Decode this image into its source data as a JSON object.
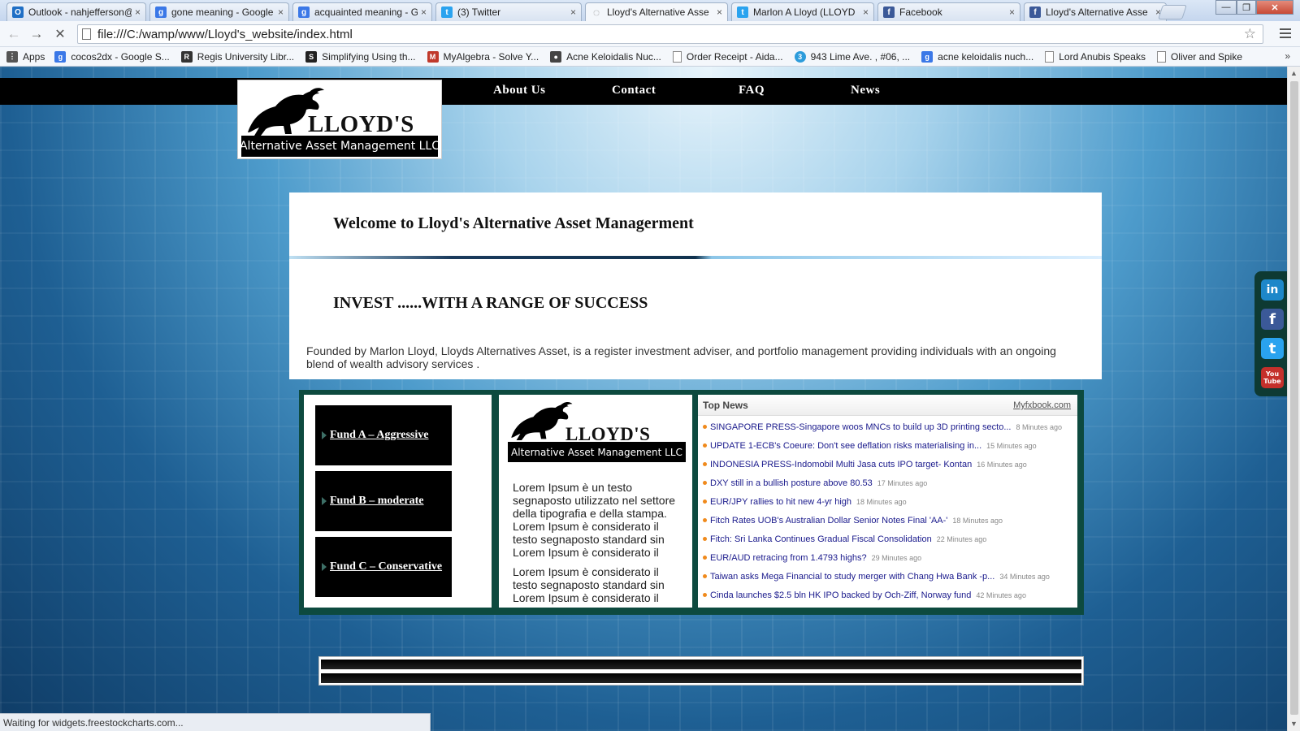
{
  "browser": {
    "tabs": [
      {
        "label": "Outlook - nahjefferson@",
        "favicon": "outlook-icon",
        "color": "#1f6fc5",
        "glyph": "O"
      },
      {
        "label": "gone meaning - Google",
        "favicon": "google-icon",
        "color": "#3b78e7",
        "glyph": "g"
      },
      {
        "label": "acquainted meaning - G",
        "favicon": "google-icon",
        "color": "#3b78e7",
        "glyph": "g"
      },
      {
        "label": "(3) Twitter",
        "favicon": "twitter-icon",
        "color": "#2aa3ef",
        "glyph": "t"
      },
      {
        "label": "Lloyd's Alternative Asse",
        "favicon": "loading-icon",
        "color": "#888888",
        "glyph": "◌"
      },
      {
        "label": "Marlon A Lloyd (LLOYD",
        "favicon": "twitter-icon",
        "color": "#2aa3ef",
        "glyph": "t"
      },
      {
        "label": "Facebook",
        "favicon": "facebook-icon",
        "color": "#3b5998",
        "glyph": "f"
      },
      {
        "label": "Lloyd's Alternative Asse",
        "favicon": "facebook-icon",
        "color": "#3b5998",
        "glyph": "f"
      }
    ],
    "tab_close_glyph": "×",
    "window_controls": {
      "minimize": "—",
      "maximize": "❐",
      "close": "✕"
    },
    "toolbar": {
      "back": "←",
      "forward": "→",
      "stop": "✕",
      "star": "☆"
    },
    "address": "file:///C:/wamp/www/Lloyd's_website/index.html",
    "bookmarks": [
      {
        "label": "Apps",
        "icon": "apps-grid-icon",
        "color": "#555555",
        "glyph": "⋮"
      },
      {
        "label": "cocos2dx - Google S...",
        "icon": "google-icon",
        "color": "#3b78e7",
        "glyph": "g"
      },
      {
        "label": "Regis University Libr...",
        "icon": "regis-icon",
        "color": "#333333",
        "glyph": "R"
      },
      {
        "label": "Simplifying Using th...",
        "icon": "document-icon",
        "color": "#222222",
        "glyph": "S"
      },
      {
        "label": "MyAlgebra - Solve Y...",
        "icon": "myalgebra-icon",
        "color": "#c0392b",
        "glyph": "M"
      },
      {
        "label": "Acne Keloidalis Nuc...",
        "icon": "people-icon",
        "color": "#444444",
        "glyph": "●"
      },
      {
        "label": "Order Receipt - Aida...",
        "icon": "page-icon",
        "color": "#ffffff",
        "glyph": ""
      },
      {
        "label": "943 Lime Ave. , #06, ...",
        "icon": "lime-icon",
        "color": "#2d9cdb",
        "glyph": "3"
      },
      {
        "label": "acne keloidalis nuch...",
        "icon": "google-icon",
        "color": "#3b78e7",
        "glyph": "g"
      },
      {
        "label": "Lord Anubis Speaks",
        "icon": "page-icon",
        "color": "#ffffff",
        "glyph": ""
      },
      {
        "label": "Oliver and Spike",
        "icon": "page-icon",
        "color": "#ffffff",
        "glyph": ""
      }
    ],
    "bookmarks_overflow": "»",
    "status": "Waiting for widgets.freestockcharts.com..."
  },
  "site": {
    "nav": [
      {
        "label": "About Us"
      },
      {
        "label": "Contact"
      },
      {
        "label": "FAQ"
      },
      {
        "label": "News"
      }
    ],
    "logo": {
      "name": "LLOYD'S",
      "tagline": "Alternative Asset Management LLC",
      "icon": "bull-logo-icon"
    },
    "welcome_title": "Welcome to Lloyd's Alternative Asset Managerment",
    "invest_title": "INVEST ......WITH A RANGE OF SUCCESS",
    "intro": "Founded by Marlon Lloyd, Lloyds Alternatives Asset, is a register investment adviser, and portfolio management providing individuals with an ongoing blend of wealth advisory services .",
    "funds": [
      {
        "label": "Fund A – Aggressive"
      },
      {
        "label": "Fund B – moderate"
      },
      {
        "label": "Fund C – Conservative"
      }
    ],
    "lorem_1": "Lorem Ipsum è un testo segnaposto utilizzato nel settore della tipografia e della stampa. Lorem Ipsum è considerato il testo segnaposto standard sin Lorem Ipsum è considerato il",
    "lorem_2": "Lorem Ipsum è considerato il testo segnaposto standard sin Lorem Ipsum è considerato il",
    "news": {
      "title": "Top News",
      "source_link": "Myfxbook.com",
      "items": [
        {
          "headline": "SINGAPORE PRESS-Singapore woos MNCs to build up 3D printing secto...",
          "time": "8 Minutes ago"
        },
        {
          "headline": "UPDATE 1-ECB's Coeure: Don't see deflation risks materialising in...",
          "time": "15 Minutes ago"
        },
        {
          "headline": "INDONESIA PRESS-Indomobil Multi Jasa cuts IPO target- Kontan",
          "time": "16 Minutes ago"
        },
        {
          "headline": "DXY still in a bullish posture above 80.53",
          "time": "17 Minutes ago"
        },
        {
          "headline": "EUR/JPY rallies to hit new 4-yr high",
          "time": "18 Minutes ago"
        },
        {
          "headline": "Fitch Rates UOB's Australian Dollar Senior Notes Final 'AA-'",
          "time": "18 Minutes ago"
        },
        {
          "headline": "Fitch: Sri Lanka Continues Gradual Fiscal Consolidation",
          "time": "22 Minutes ago"
        },
        {
          "headline": "EUR/AUD retracing from 1.4793 highs?",
          "time": "29 Minutes ago"
        },
        {
          "headline": "Taiwan asks Mega Financial to study merger with Chang Hwa Bank -p...",
          "time": "34 Minutes ago"
        },
        {
          "headline": "Cinda launches $2.5 bln HK IPO backed by Och-Ziff, Norway fund",
          "time": "42 Minutes ago"
        }
      ]
    },
    "social": [
      {
        "name": "linkedin-icon",
        "glyph": "in",
        "color": "#1d87c9"
      },
      {
        "name": "facebook-icon",
        "glyph": "f",
        "color": "#3b5998"
      },
      {
        "name": "twitter-icon",
        "glyph": "t",
        "color": "#2aa3ef"
      },
      {
        "name": "youtube-icon",
        "glyph": "You Tube",
        "color": "#c4302b"
      }
    ]
  },
  "colors": {
    "frame": "#0d4a3f",
    "nav_bg": "#000000",
    "news_bullet": "#f08a1c"
  }
}
